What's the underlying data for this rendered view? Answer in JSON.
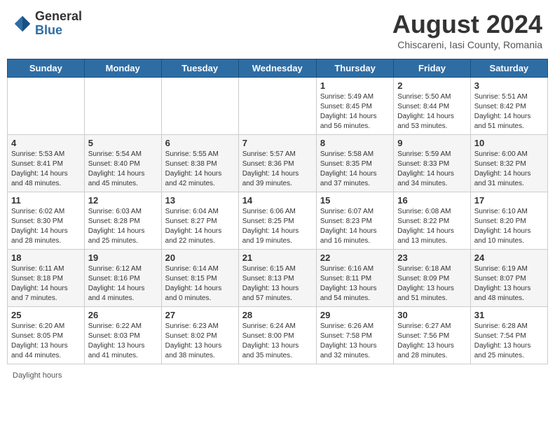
{
  "header": {
    "logo_general": "General",
    "logo_blue": "Blue",
    "month_year": "August 2024",
    "location": "Chiscareni, Iasi County, Romania"
  },
  "days_of_week": [
    "Sunday",
    "Monday",
    "Tuesday",
    "Wednesday",
    "Thursday",
    "Friday",
    "Saturday"
  ],
  "footer": {
    "daylight_label": "Daylight hours"
  },
  "weeks": [
    [
      {
        "day": "",
        "info": ""
      },
      {
        "day": "",
        "info": ""
      },
      {
        "day": "",
        "info": ""
      },
      {
        "day": "",
        "info": ""
      },
      {
        "day": "1",
        "info": "Sunrise: 5:49 AM\nSunset: 8:45 PM\nDaylight: 14 hours\nand 56 minutes."
      },
      {
        "day": "2",
        "info": "Sunrise: 5:50 AM\nSunset: 8:44 PM\nDaylight: 14 hours\nand 53 minutes."
      },
      {
        "day": "3",
        "info": "Sunrise: 5:51 AM\nSunset: 8:42 PM\nDaylight: 14 hours\nand 51 minutes."
      }
    ],
    [
      {
        "day": "4",
        "info": "Sunrise: 5:53 AM\nSunset: 8:41 PM\nDaylight: 14 hours\nand 48 minutes."
      },
      {
        "day": "5",
        "info": "Sunrise: 5:54 AM\nSunset: 8:40 PM\nDaylight: 14 hours\nand 45 minutes."
      },
      {
        "day": "6",
        "info": "Sunrise: 5:55 AM\nSunset: 8:38 PM\nDaylight: 14 hours\nand 42 minutes."
      },
      {
        "day": "7",
        "info": "Sunrise: 5:57 AM\nSunset: 8:36 PM\nDaylight: 14 hours\nand 39 minutes."
      },
      {
        "day": "8",
        "info": "Sunrise: 5:58 AM\nSunset: 8:35 PM\nDaylight: 14 hours\nand 37 minutes."
      },
      {
        "day": "9",
        "info": "Sunrise: 5:59 AM\nSunset: 8:33 PM\nDaylight: 14 hours\nand 34 minutes."
      },
      {
        "day": "10",
        "info": "Sunrise: 6:00 AM\nSunset: 8:32 PM\nDaylight: 14 hours\nand 31 minutes."
      }
    ],
    [
      {
        "day": "11",
        "info": "Sunrise: 6:02 AM\nSunset: 8:30 PM\nDaylight: 14 hours\nand 28 minutes."
      },
      {
        "day": "12",
        "info": "Sunrise: 6:03 AM\nSunset: 8:28 PM\nDaylight: 14 hours\nand 25 minutes."
      },
      {
        "day": "13",
        "info": "Sunrise: 6:04 AM\nSunset: 8:27 PM\nDaylight: 14 hours\nand 22 minutes."
      },
      {
        "day": "14",
        "info": "Sunrise: 6:06 AM\nSunset: 8:25 PM\nDaylight: 14 hours\nand 19 minutes."
      },
      {
        "day": "15",
        "info": "Sunrise: 6:07 AM\nSunset: 8:23 PM\nDaylight: 14 hours\nand 16 minutes."
      },
      {
        "day": "16",
        "info": "Sunrise: 6:08 AM\nSunset: 8:22 PM\nDaylight: 14 hours\nand 13 minutes."
      },
      {
        "day": "17",
        "info": "Sunrise: 6:10 AM\nSunset: 8:20 PM\nDaylight: 14 hours\nand 10 minutes."
      }
    ],
    [
      {
        "day": "18",
        "info": "Sunrise: 6:11 AM\nSunset: 8:18 PM\nDaylight: 14 hours\nand 7 minutes."
      },
      {
        "day": "19",
        "info": "Sunrise: 6:12 AM\nSunset: 8:16 PM\nDaylight: 14 hours\nand 4 minutes."
      },
      {
        "day": "20",
        "info": "Sunrise: 6:14 AM\nSunset: 8:15 PM\nDaylight: 14 hours and 0 minutes."
      },
      {
        "day": "21",
        "info": "Sunrise: 6:15 AM\nSunset: 8:13 PM\nDaylight: 13 hours\nand 57 minutes."
      },
      {
        "day": "22",
        "info": "Sunrise: 6:16 AM\nSunset: 8:11 PM\nDaylight: 13 hours\nand 54 minutes."
      },
      {
        "day": "23",
        "info": "Sunrise: 6:18 AM\nSunset: 8:09 PM\nDaylight: 13 hours\nand 51 minutes."
      },
      {
        "day": "24",
        "info": "Sunrise: 6:19 AM\nSunset: 8:07 PM\nDaylight: 13 hours\nand 48 minutes."
      }
    ],
    [
      {
        "day": "25",
        "info": "Sunrise: 6:20 AM\nSunset: 8:05 PM\nDaylight: 13 hours\nand 44 minutes."
      },
      {
        "day": "26",
        "info": "Sunrise: 6:22 AM\nSunset: 8:03 PM\nDaylight: 13 hours\nand 41 minutes."
      },
      {
        "day": "27",
        "info": "Sunrise: 6:23 AM\nSunset: 8:02 PM\nDaylight: 13 hours\nand 38 minutes."
      },
      {
        "day": "28",
        "info": "Sunrise: 6:24 AM\nSunset: 8:00 PM\nDaylight: 13 hours\nand 35 minutes."
      },
      {
        "day": "29",
        "info": "Sunrise: 6:26 AM\nSunset: 7:58 PM\nDaylight: 13 hours\nand 32 minutes."
      },
      {
        "day": "30",
        "info": "Sunrise: 6:27 AM\nSunset: 7:56 PM\nDaylight: 13 hours\nand 28 minutes."
      },
      {
        "day": "31",
        "info": "Sunrise: 6:28 AM\nSunset: 7:54 PM\nDaylight: 13 hours\nand 25 minutes."
      }
    ]
  ]
}
